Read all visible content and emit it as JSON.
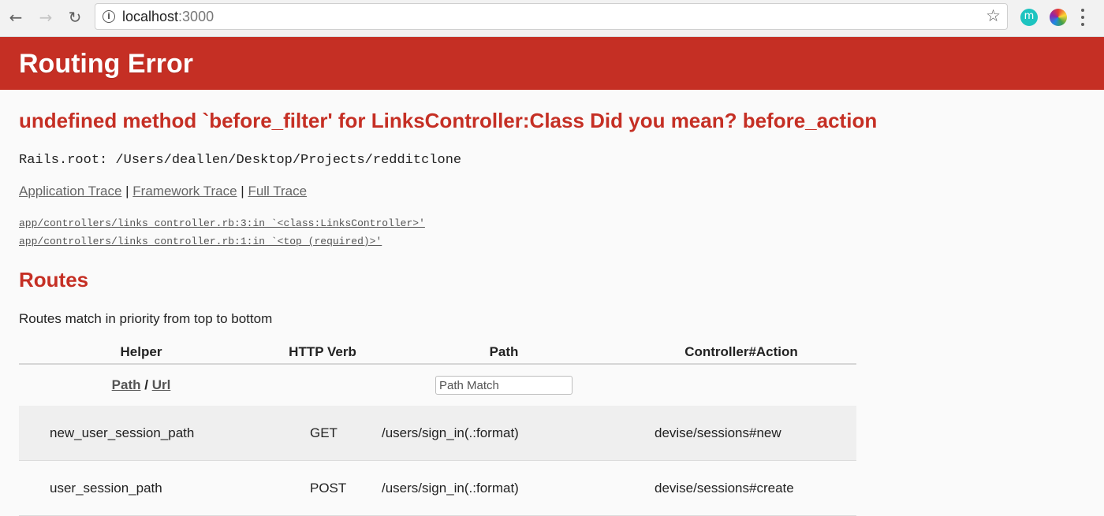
{
  "browser": {
    "url_host": "localhost",
    "url_port": ":3000",
    "icons": [
      "back-icon",
      "forward-icon",
      "reload-icon",
      "info-icon",
      "bookmark-star-icon",
      "extension-m-icon",
      "extension-color-icon",
      "menu-icon"
    ]
  },
  "header": {
    "title": "Routing Error"
  },
  "error": {
    "message": "undefined method `before_filter' for LinksController:Class Did you mean? before_action",
    "rails_root": "Rails.root: /Users/deallen/Desktop/Projects/redditclone"
  },
  "trace": {
    "links": [
      "Application Trace",
      "Framework Trace",
      "Full Trace"
    ],
    "separator": "|",
    "lines": [
      "app/controllers/links_controller.rb:3:in `<class:LinksController>'",
      "app/controllers/links_controller.rb:1:in `<top (required)>'"
    ]
  },
  "routes": {
    "title": "Routes",
    "description": "Routes match in priority from top to bottom",
    "columns": [
      "Helper",
      "HTTP Verb",
      "Path",
      "Controller#Action"
    ],
    "filter": {
      "path_link": "Path",
      "separator": "/",
      "url_link": "Url",
      "placeholder": "Path Match"
    },
    "rows": [
      {
        "helper": "new_user_session_path",
        "verb": "GET",
        "path": "/users/sign_in(.:format)",
        "action": "devise/sessions#new"
      },
      {
        "helper": "user_session_path",
        "verb": "POST",
        "path": "/users/sign_in(.:format)",
        "action": "devise/sessions#create"
      }
    ]
  },
  "colors": {
    "accent": "#c52f24",
    "row_shade": "#efefef"
  }
}
